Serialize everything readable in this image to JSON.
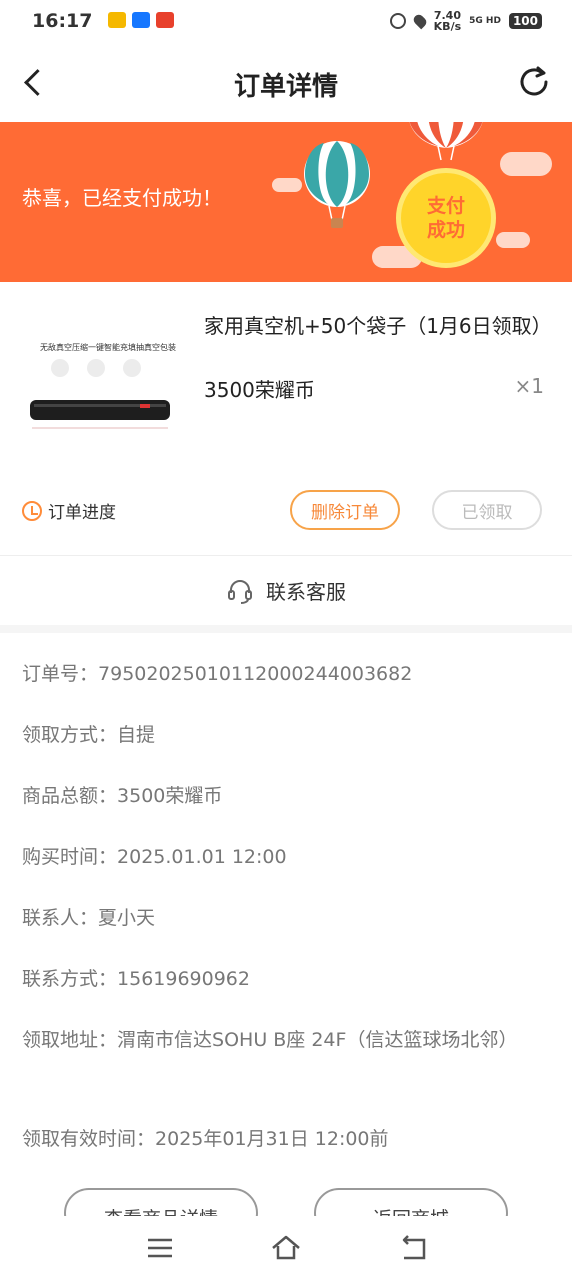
{
  "status_bar": {
    "time": "16:17",
    "net_speed_value": "7.40",
    "net_speed_unit": "KB/s",
    "signal": "5G HD",
    "battery": "100"
  },
  "nav": {
    "title": "订单详情"
  },
  "banner": {
    "message": "恭喜，已经支付成功！",
    "badge": "支付成功",
    "bg_color": "#ff6b35"
  },
  "product": {
    "name": "家用真空机+50个袋子（1月6日领取）",
    "price": "3500荣耀币",
    "quantity": "×1",
    "progress_label": "订单进度",
    "delete_label": "删除订单",
    "claimed_label": "已领取",
    "image_caption": "无敌真空压缩一键智能充填抽真空包装"
  },
  "contact": {
    "label": "联系客服"
  },
  "details": [
    {
      "label": "订单号：",
      "value": "79502025010112000244003682"
    },
    {
      "label": "领取方式：",
      "value": "自提"
    },
    {
      "label": "商品总额：",
      "value": "3500荣耀币"
    },
    {
      "label": "购买时间：",
      "value": "2025.01.01 12:00"
    },
    {
      "label": "联系人：",
      "value": "夏小天"
    },
    {
      "label": "联系方式：",
      "value": "15619690962"
    },
    {
      "label": "领取地址：",
      "value": "渭南市信达SOHU B座 24F（信达篮球场北邻）"
    },
    {
      "label": "领取有效时间：",
      "value": "2025年01月31日 12:00前"
    }
  ],
  "bottom_actions": {
    "view_product": "查看商品详情",
    "back_to_mall": "返回商城"
  }
}
